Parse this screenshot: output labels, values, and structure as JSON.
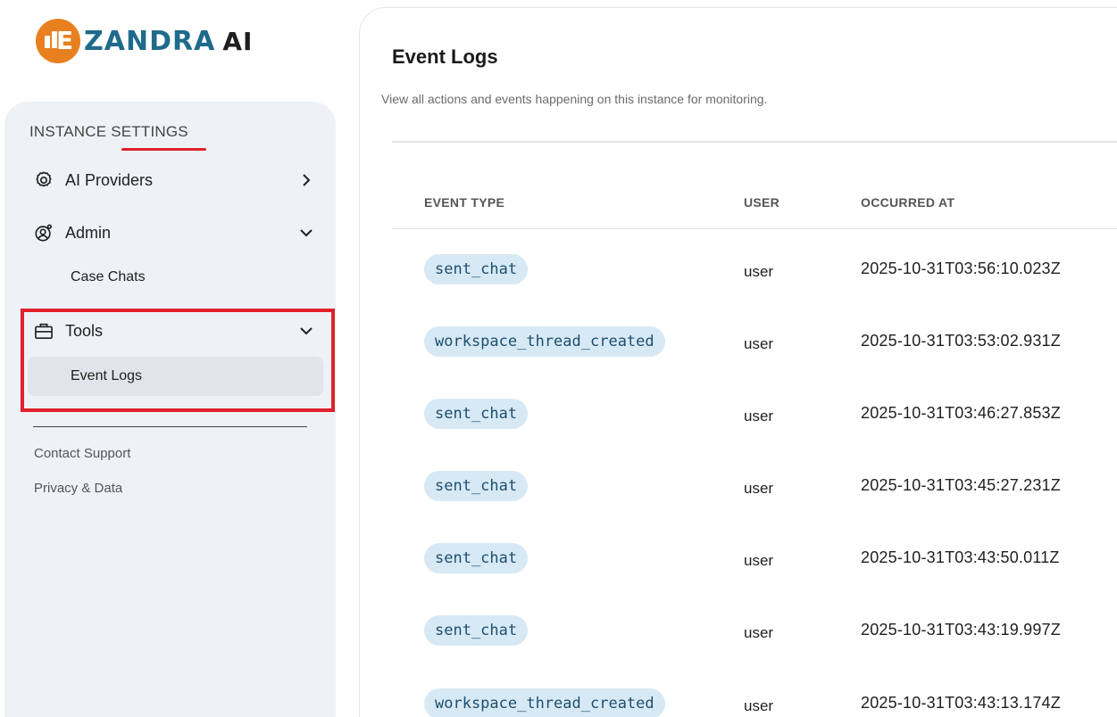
{
  "logo": {
    "brand": "ZANDRA",
    "suffix": "AI"
  },
  "sidebar": {
    "section_title_part1": "INSTANCE ",
    "section_title_part2": "SETTINGS",
    "items": [
      {
        "label": "AI Providers",
        "icon": "gear-icon",
        "chevron": "chevron-right-icon"
      },
      {
        "label": "Admin",
        "icon": "user-gear-icon",
        "chevron": "chevron-down-icon",
        "sub": [
          "Case Chats"
        ]
      },
      {
        "label": "Tools",
        "icon": "briefcase-icon",
        "chevron": "chevron-down-icon",
        "sub": [
          "Event Logs"
        ]
      }
    ],
    "footer_links": [
      "Contact Support",
      "Privacy & Data"
    ]
  },
  "main": {
    "title": "Event Logs",
    "description": "View all actions and events happening on this instance for monitoring.",
    "columns": [
      "EVENT TYPE",
      "USER",
      "OCCURRED AT"
    ],
    "rows": [
      {
        "event": "sent_chat",
        "user": "user",
        "time": "2025-10-31T03:56:10.023Z"
      },
      {
        "event": "workspace_thread_created",
        "user": "user",
        "time": "2025-10-31T03:53:02.931Z"
      },
      {
        "event": "sent_chat",
        "user": "user",
        "time": "2025-10-31T03:46:27.853Z"
      },
      {
        "event": "sent_chat",
        "user": "user",
        "time": "2025-10-31T03:45:27.231Z"
      },
      {
        "event": "sent_chat",
        "user": "user",
        "time": "2025-10-31T03:43:50.011Z"
      },
      {
        "event": "sent_chat",
        "user": "user",
        "time": "2025-10-31T03:43:19.997Z"
      },
      {
        "event": "workspace_thread_created",
        "user": "user",
        "time": "2025-10-31T03:43:13.174Z"
      }
    ]
  },
  "colors": {
    "accent_red": "#e0212b",
    "pill_bg": "#d7e9f5",
    "pill_text": "#1d4f6e",
    "logo_orange": "#e8801f",
    "logo_blue": "#1e6b8c"
  }
}
